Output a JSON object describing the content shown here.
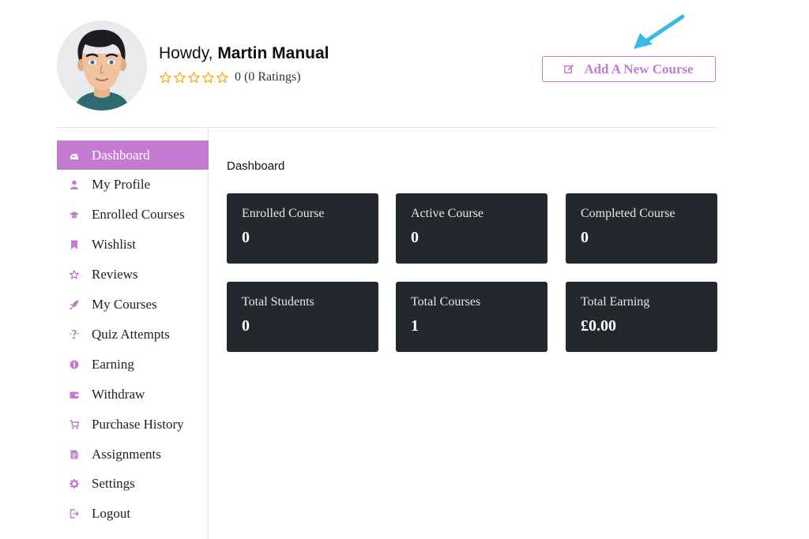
{
  "header": {
    "greeting_prefix": "Howdy,",
    "user_name": "Martin Manual",
    "rating_value": 0,
    "rating_max": 5,
    "rating_text": "0 (0 Ratings)",
    "add_course_label": "Add A New Course"
  },
  "sidebar": {
    "items": [
      {
        "label": "Dashboard",
        "icon": "dashboard-icon",
        "active": true
      },
      {
        "label": "My Profile",
        "icon": "user-icon",
        "active": false
      },
      {
        "label": "Enrolled Courses",
        "icon": "graduation-cap-icon",
        "active": false
      },
      {
        "label": "Wishlist",
        "icon": "bookmark-icon",
        "active": false
      },
      {
        "label": "Reviews",
        "icon": "star-icon",
        "active": false
      },
      {
        "label": "My Courses",
        "icon": "rocket-icon",
        "active": false
      },
      {
        "label": "Quiz Attempts",
        "icon": "quiz-icon",
        "active": false
      },
      {
        "label": "Earning",
        "icon": "coin-icon",
        "active": false
      },
      {
        "label": "Withdraw",
        "icon": "wallet-icon",
        "active": false
      },
      {
        "label": "Purchase History",
        "icon": "cart-icon",
        "active": false
      },
      {
        "label": "Assignments",
        "icon": "document-icon",
        "active": false
      },
      {
        "label": "Settings",
        "icon": "gear-icon",
        "active": false
      },
      {
        "label": "Logout",
        "icon": "logout-icon",
        "active": false
      }
    ]
  },
  "main": {
    "title": "Dashboard",
    "cards": [
      {
        "label": "Enrolled Course",
        "value": "0"
      },
      {
        "label": "Active Course",
        "value": "0"
      },
      {
        "label": "Completed Course",
        "value": "0"
      },
      {
        "label": "Total Students",
        "value": "0"
      },
      {
        "label": "Total Courses",
        "value": "1"
      },
      {
        "label": "Total Earning",
        "value": "£0.00"
      }
    ]
  },
  "colors": {
    "accent": "#c27bd1",
    "card_bg": "#25272f",
    "star": "#f2b01e",
    "arrow": "#3bb8e8"
  }
}
